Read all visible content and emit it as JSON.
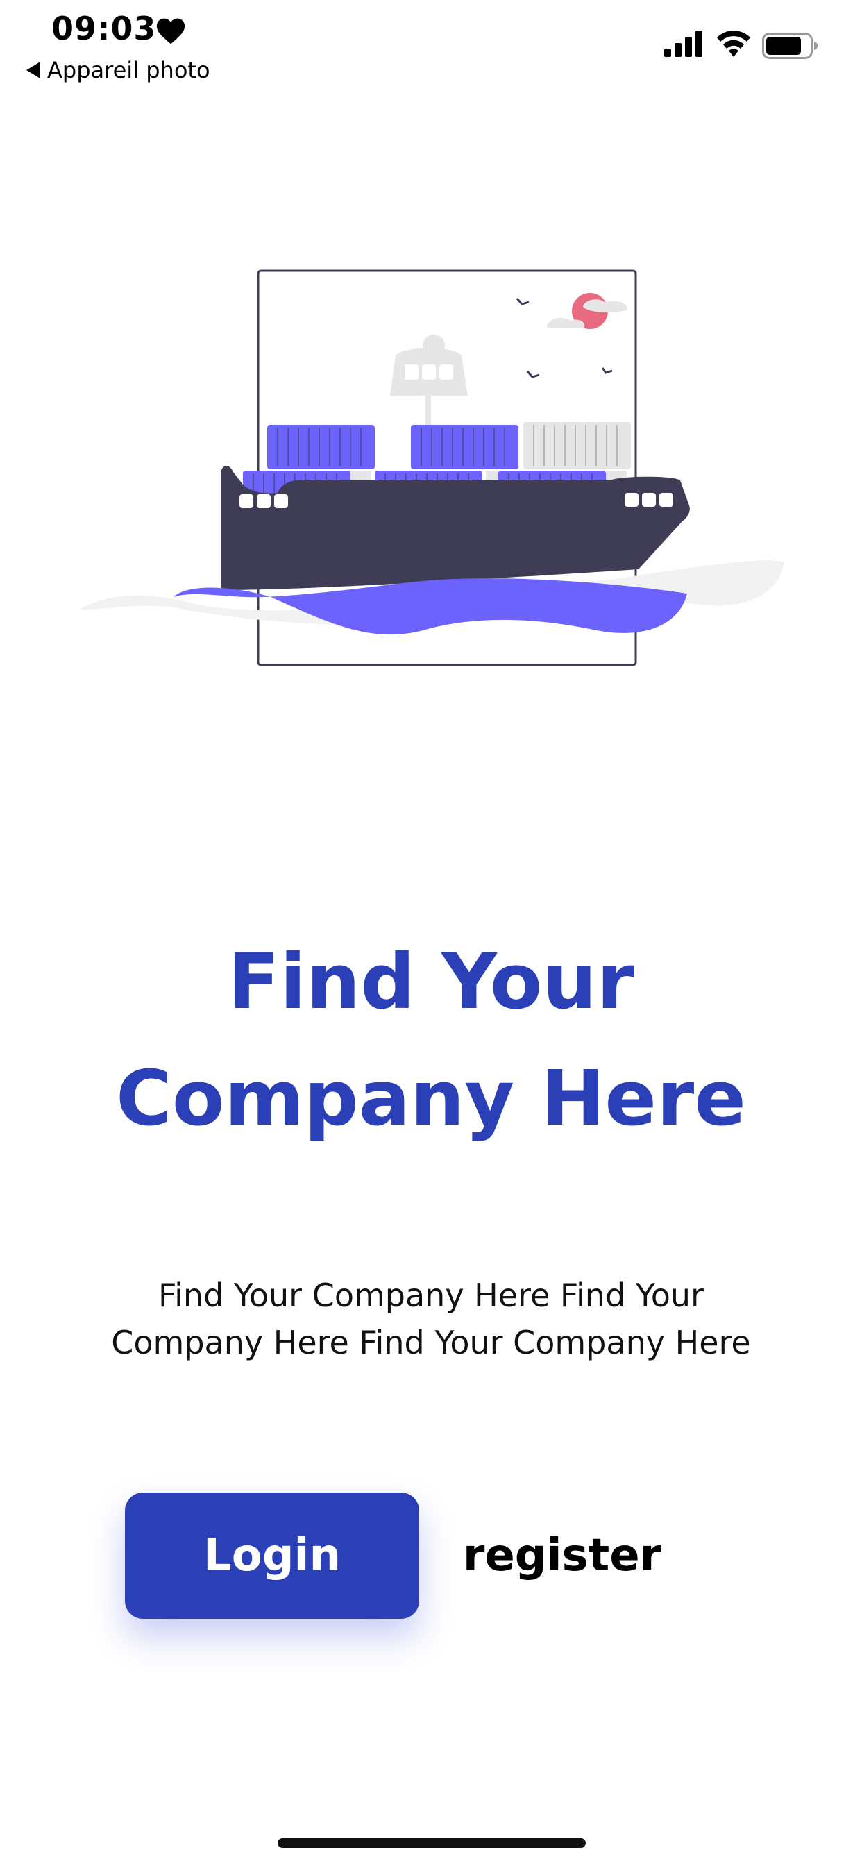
{
  "status_bar": {
    "time": "09:03",
    "back_label": "Appareil photo",
    "icons": [
      "heart-icon",
      "signal-icon",
      "wifi-icon",
      "battery-icon"
    ]
  },
  "illustration": {
    "subject": "container-ship-illustration",
    "colors": {
      "accent": "#6c63ff",
      "hull": "#3f3d56",
      "sun": "#e86a7f",
      "ground": "#f2f2f2"
    }
  },
  "hero": {
    "title_line1": "Find Your",
    "title_line2": "Company Here",
    "description": "Find Your Company Here Find Your Company Here Find Your Company Here"
  },
  "actions": {
    "login_label": "Login",
    "register_label": "register"
  },
  "colors": {
    "primary": "#2b3fb7",
    "text": "#000000",
    "background": "#ffffff"
  }
}
